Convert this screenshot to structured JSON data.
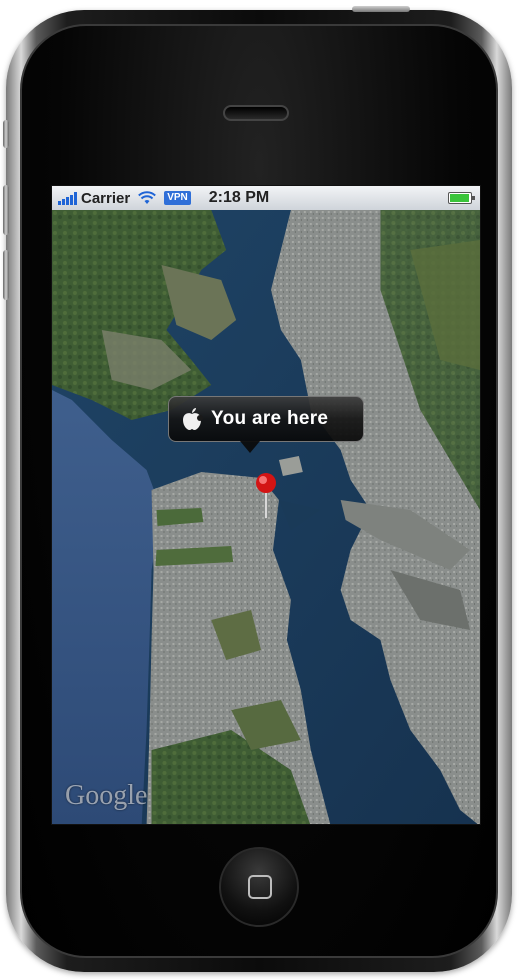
{
  "status_bar": {
    "carrier": "Carrier",
    "vpn_label": "VPN",
    "time": "2:18 PM",
    "signal_icon": "signal-bars-icon",
    "wifi_icon": "wifi-icon",
    "battery_icon": "battery-icon",
    "battery_level": 0.95,
    "accent_color": "#1e64d6",
    "battery_color": "#3ac43a"
  },
  "map": {
    "callout_label": "You are here",
    "callout_icon": "apple-icon",
    "pin_icon": "red-pin-icon",
    "pin_color": "#e02020",
    "provider": "Google"
  },
  "device": {
    "home_button_icon": "home-square-icon"
  }
}
